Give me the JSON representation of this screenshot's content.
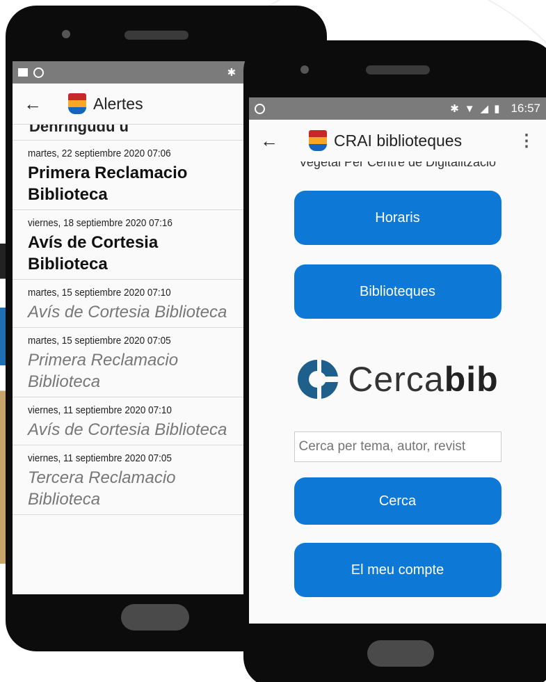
{
  "back_phone": {
    "status_icons": [
      "image-icon",
      "whatsapp-icon",
      "bluetooth-icon",
      "wifi-icon"
    ],
    "app_title": "Alertes",
    "cut_title": "Denringudu u",
    "alerts": [
      {
        "date": "martes, 22 septiembre 2020 07:06",
        "title": "Primera Reclamacio Biblioteca",
        "title_line1": "Primera Reclamacio",
        "title_line2": "Biblioteca",
        "read": false
      },
      {
        "date": "viernes, 18 septiembre 2020 07:16",
        "title": "Avís de Cortesia Biblioteca",
        "title_line1": "Avís de Cortesia",
        "title_line2": "Biblioteca",
        "read": false
      },
      {
        "date": "martes, 15 septiembre 2020 07:10",
        "title": "Avís de Cortesia Biblioteca",
        "title_line1": "Avís de Cortesia Biblioteca",
        "title_line2": "",
        "read": true
      },
      {
        "date": "martes, 15 septiembre 2020 07:05",
        "title": "Primera Reclamacio Biblioteca",
        "title_line1": "Primera Reclamacio",
        "title_line2": "Biblioteca",
        "read": true
      },
      {
        "date": "viernes, 11 septiembre 2020 07:10",
        "title": "Avís de Cortesia Biblioteca",
        "title_line1": "Avís de Cortesia Biblioteca",
        "title_line2": "",
        "read": true
      },
      {
        "date": "viernes, 11 septiembre 2020 07:05",
        "title": "Tercera Reclamacio Biblioteca",
        "title_line1": "Tercera Reclamacio",
        "title_line2": "Biblioteca",
        "read": true
      }
    ]
  },
  "front_phone": {
    "status_time": "16:57",
    "app_title": "CRAI biblioteques",
    "cut_text": "Vegetal Per Centre de Digitalització",
    "buttons": {
      "horaris": "Horaris",
      "biblioteques": "Biblioteques",
      "cerca": "Cerca",
      "compte": "El meu compte"
    },
    "cercabib": {
      "light": "Cerca",
      "bold": "bib"
    },
    "search": {
      "placeholder": "Cerca per tema, autor, revist",
      "value": ""
    },
    "colors": {
      "button": "#0e78d7",
      "logo": "#1f5f8b"
    }
  }
}
